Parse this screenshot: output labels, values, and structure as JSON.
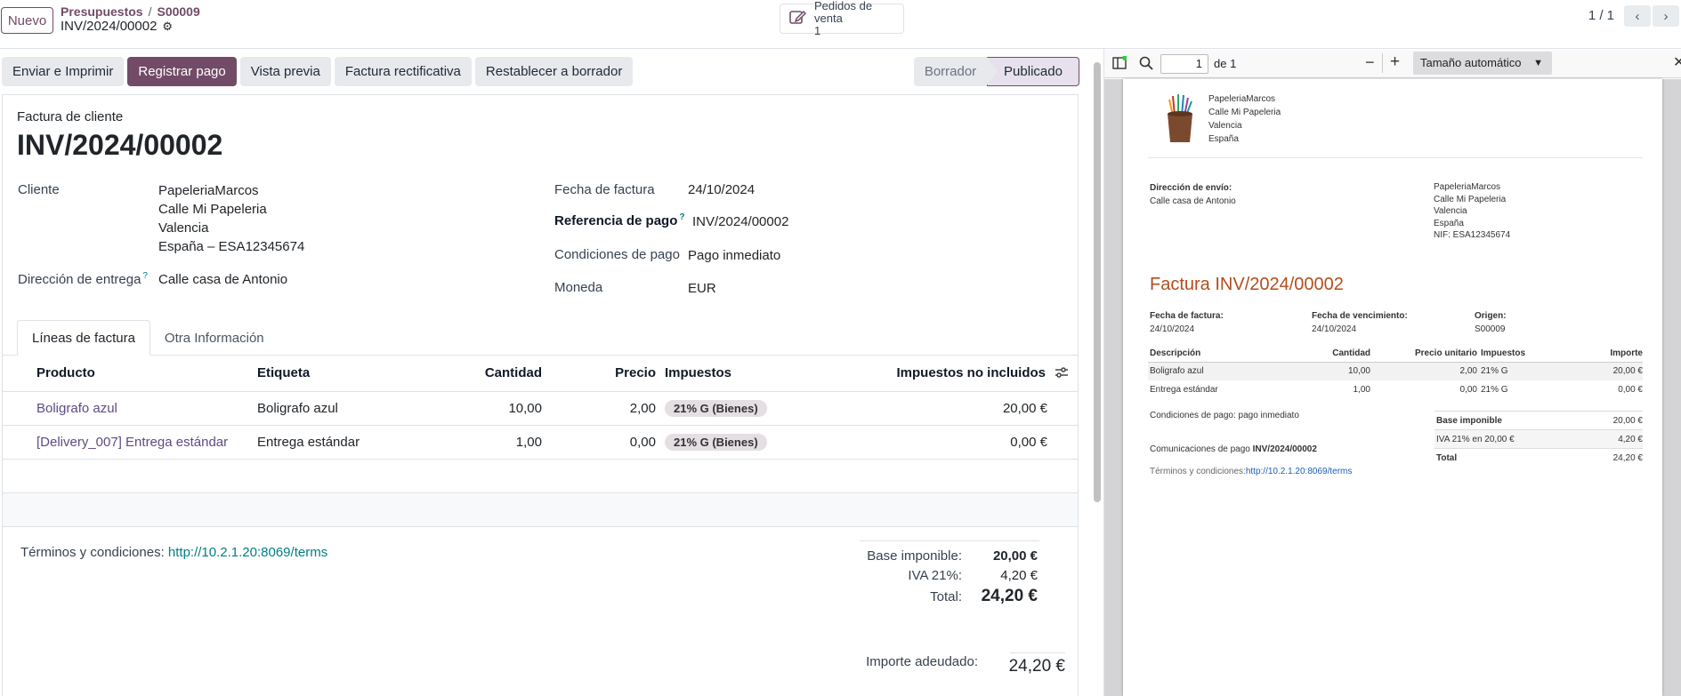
{
  "topbar": {
    "new_label": "Nuevo",
    "breadcrumb": [
      "Presupuestos",
      "S00009"
    ],
    "record_name": "INV/2024/00002",
    "smart_button": {
      "label": "Pedidos de venta",
      "count": "1"
    },
    "pager": "1 / 1"
  },
  "actions": [
    "Enviar e Imprimir",
    "Registrar pago",
    "Vista previa",
    "Factura rectificativa",
    "Restablecer a borrador"
  ],
  "status": {
    "draft": "Borrador",
    "posted": "Publicado"
  },
  "form": {
    "doc_type": "Factura de cliente",
    "doc_name": "INV/2024/00002",
    "customer_label": "Cliente",
    "customer_name": "PapeleriaMarcos",
    "customer_addr1": "Calle Mi Papeleria",
    "customer_addr2": "Valencia",
    "customer_addr3": "España – ESA12345674",
    "delivery_label": "Dirección de entrega",
    "delivery_value": "Calle casa de Antonio",
    "invoice_date_label": "Fecha de factura",
    "invoice_date": "24/10/2024",
    "payment_ref_label": "Referencia de pago",
    "payment_ref": "INV/2024/00002",
    "payment_terms_label": "Condiciones de pago",
    "payment_terms": "Pago inmediato",
    "currency_label": "Moneda",
    "currency": "EUR"
  },
  "tabs": [
    "Líneas de factura",
    "Otra Información"
  ],
  "lines": {
    "headers": [
      "Producto",
      "Etiqueta",
      "Cantidad",
      "Precio",
      "Impuestos",
      "Impuestos no incluidos"
    ],
    "rows": [
      {
        "product": "Boligrafo azul",
        "label": "Boligrafo azul",
        "qty": "10,00",
        "price": "2,00",
        "tax": "21% G (Bienes)",
        "subtotal": "20,00 €"
      },
      {
        "product": "[Delivery_007] Entrega estándar",
        "label": "Entrega estándar",
        "qty": "1,00",
        "price": "0,00",
        "tax": "21% G (Bienes)",
        "subtotal": "0,00 €"
      }
    ]
  },
  "footer": {
    "terms_label": "Términos y condiciones:",
    "terms_link": "http://10.2.1.20:8069/terms",
    "base_label": "Base imponible:",
    "base_value": "20,00 €",
    "iva_label": "IVA 21%:",
    "iva_value": "4,20 €",
    "total_label": "Total:",
    "total_value": "24,20 €",
    "due_label": "Importe adeudado:",
    "due_value": "24,20 €"
  },
  "pdf": {
    "page": "1",
    "page_of": "de 1",
    "zoom": "Tamaño automático",
    "company": [
      "PapeleriaMarcos",
      "Calle Mi Papeleria",
      "Valencia",
      "España"
    ],
    "shipping_label": "Dirección de envío:",
    "shipping_value": "Calle casa de Antonio",
    "partner": [
      "PapeleriaMarcos",
      "Calle Mi Papeleria",
      "Valencia",
      "España",
      "NIF: ESA12345674"
    ],
    "title": "Factura INV/2024/00002",
    "meta": [
      {
        "label": "Fecha de factura:",
        "value": "24/10/2024"
      },
      {
        "label": "Fecha de vencimiento:",
        "value": "24/10/2024"
      },
      {
        "label": "Origen:",
        "value": "S00009"
      }
    ],
    "table_headers": [
      "Descripción",
      "Cantidad",
      "Precio unitario",
      "Impuestos",
      "Importe"
    ],
    "table_rows": [
      [
        "Boligrafo azul",
        "10,00",
        "2,00",
        "21% G",
        "20,00 €"
      ],
      [
        "Entrega estándar",
        "1,00",
        "0,00",
        "21% G",
        "0,00 €"
      ]
    ],
    "payment_terms": "Condiciones de pago: pago inmediato",
    "payment_comm_label": "Comunicaciones de pago",
    "payment_comm_value": "INV/2024/00002",
    "terms_label": "Términos y condiciones:",
    "terms_link": "http://10.2.1.20:8069/terms",
    "sum": [
      {
        "label": "Base imponible",
        "value": "20,00 €"
      },
      {
        "label": "IVA 21% en 20,00 €",
        "value": "4,20 €"
      },
      {
        "label": "Total",
        "value": "24,20 €"
      }
    ]
  }
}
